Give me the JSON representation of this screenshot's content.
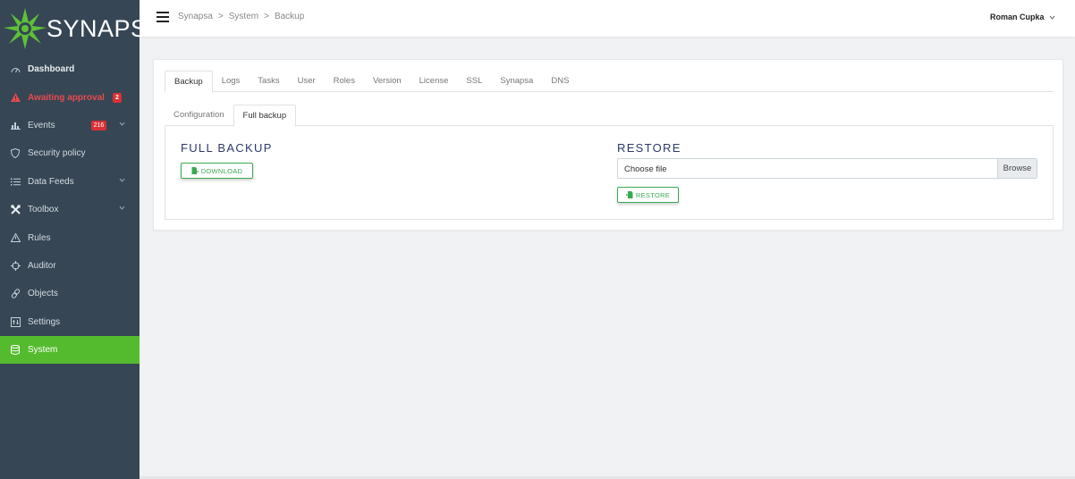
{
  "brand": {
    "name": "SYNAPSA",
    "accent": "#55bb2e",
    "sidebar_bg": "#364654"
  },
  "sidebar": {
    "items": [
      {
        "label": "Dashboard",
        "icon": "dashboard-gauge-icon"
      },
      {
        "label": "Awaiting approval",
        "icon": "warning-triangle-icon",
        "badge": "2"
      },
      {
        "label": "Events",
        "icon": "bar-chart-icon",
        "badge": "216"
      },
      {
        "label": "Security policy",
        "icon": "shield-icon"
      },
      {
        "label": "Data Feeds",
        "icon": "list-icon"
      },
      {
        "label": "Toolbox",
        "icon": "tools-icon"
      },
      {
        "label": "Rules",
        "icon": "warning-outline-icon"
      },
      {
        "label": "Auditor",
        "icon": "crosshair-icon"
      },
      {
        "label": "Objects",
        "icon": "link-icon"
      },
      {
        "label": "Settings",
        "icon": "settings-panel-icon"
      },
      {
        "label": "System",
        "icon": "database-icon"
      }
    ]
  },
  "header": {
    "breadcrumb": [
      "Synapsa",
      "System",
      "Backup"
    ],
    "breadcrumb_sep": ">",
    "user": "Roman Cupka"
  },
  "tabs": [
    "Backup",
    "Logs",
    "Tasks",
    "User",
    "Roles",
    "Version",
    "License",
    "SSL",
    "Synapsa",
    "DNS"
  ],
  "subtabs": [
    "Configuration",
    "Full backup"
  ],
  "full_backup": {
    "title": "FULL BACKUP",
    "download_label": "DOWNLOAD"
  },
  "restore": {
    "title": "RESTORE",
    "file_placeholder": "Choose file",
    "browse_label": "Browse",
    "restore_label": "RESTORE"
  }
}
